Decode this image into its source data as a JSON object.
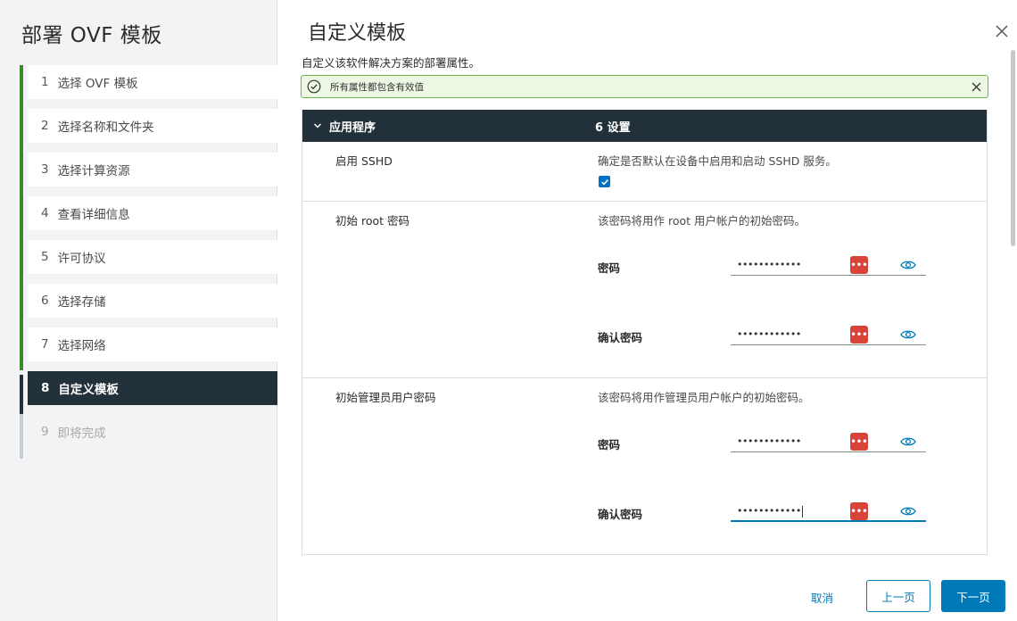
{
  "wizard": {
    "title": "部署 OVF 模板",
    "steps": [
      {
        "num": "1",
        "label": "选择 OVF 模板"
      },
      {
        "num": "2",
        "label": "选择名称和文件夹"
      },
      {
        "num": "3",
        "label": "选择计算资源"
      },
      {
        "num": "4",
        "label": "查看详细信息"
      },
      {
        "num": "5",
        "label": "许可协议"
      },
      {
        "num": "6",
        "label": "选择存储"
      },
      {
        "num": "7",
        "label": "选择网络"
      },
      {
        "num": "8",
        "label": "自定义模板"
      },
      {
        "num": "9",
        "label": "即将完成"
      }
    ]
  },
  "page": {
    "title": "自定义模板",
    "subtitle": "自定义该软件解决方案的部署属性。",
    "alert": "所有属性都包含有效值"
  },
  "group": {
    "name": "应用程序",
    "count": "6 设置"
  },
  "rows": {
    "sshd": {
      "label": "启用 SSHD",
      "desc": "确定是否默认在设备中启用和启动 SSHD 服务。",
      "checked": true
    },
    "root_pw": {
      "label": "初始 root 密码",
      "desc": "该密码将用作 root 用户帐户的初始密码。",
      "field1": "密码",
      "field2": "确认密码",
      "value1": "••••••••••••",
      "value2": "••••••••••••"
    },
    "admin_pw": {
      "label": "初始管理员用户密码",
      "desc": "该密码将用作管理员用户帐户的初始密码。",
      "field1": "密码",
      "field2": "确认密码",
      "value1": "••••••••••••",
      "value2": "••••••••••••"
    }
  },
  "password_manager_icon": "•••",
  "footer": {
    "cancel": "取消",
    "back": "上一页",
    "next": "下一页"
  },
  "colors": {
    "accent": "#0079b8",
    "dark_header": "#22303a",
    "success": "#3a8a2b",
    "alert_bg": "#ecf8e4",
    "key_icon": "#d9443a"
  }
}
